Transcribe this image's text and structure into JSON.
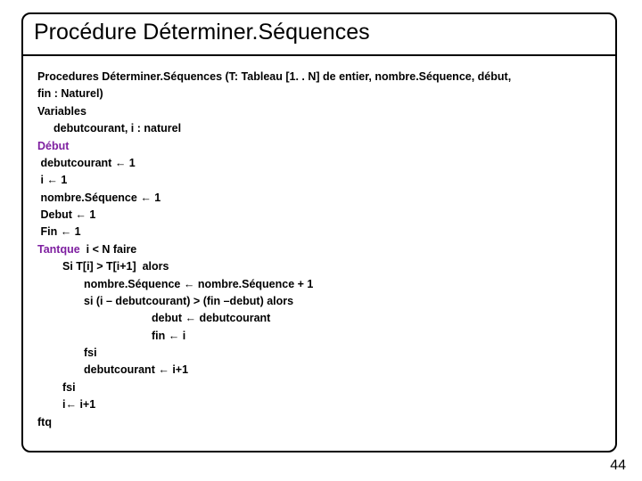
{
  "title": "Procédure Déterminer.Séquences",
  "lines": {
    "l1": "Procedures Déterminer.Séquences (T: Tableau [1. . N] de entier, nombre.Séquence, début,",
    "l2": "fin : Naturel)",
    "l3": "Variables",
    "l4": "debutcourant, i : naturel",
    "l5a": "Début",
    "l6a": " debutcourant ",
    "l6b": " 1",
    "l7a": " i ",
    "l7b": " 1",
    "l8a": " nombre.Séquence ",
    "l8b": " 1",
    "l9a": " Debut ",
    "l9b": " 1",
    "l10a": " Fin ",
    "l10b": " 1",
    "l11a": "Tantque",
    "l11b": "  i < N faire",
    "l12": "Si T[i] > T[i+1]  alors",
    "l13a": "nombre.Séquence ",
    "l13b": " nombre.Séquence + 1",
    "l14": "si (i – debutcourant) > (fin –debut) alors",
    "l15a": "debut ",
    "l15b": " debutcourant",
    "l16a": "fin ",
    "l16b": " i",
    "l17": "fsi",
    "l18a": "debutcourant ",
    "l18b": " i+1",
    "l19": "fsi",
    "l20a": "i",
    "l20b": " i+1",
    "l21": "ftq"
  },
  "arrow": "←",
  "page": "44"
}
